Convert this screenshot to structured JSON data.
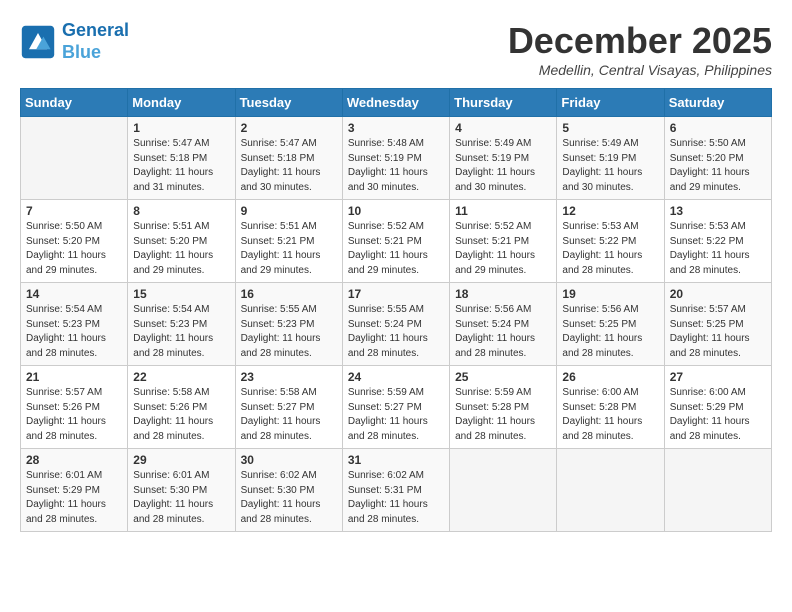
{
  "header": {
    "logo_line1": "General",
    "logo_line2": "Blue",
    "month": "December 2025",
    "location": "Medellin, Central Visayas, Philippines"
  },
  "weekdays": [
    "Sunday",
    "Monday",
    "Tuesday",
    "Wednesday",
    "Thursday",
    "Friday",
    "Saturday"
  ],
  "weeks": [
    [
      {
        "day": "",
        "info": ""
      },
      {
        "day": "1",
        "info": "Sunrise: 5:47 AM\nSunset: 5:18 PM\nDaylight: 11 hours\nand 31 minutes."
      },
      {
        "day": "2",
        "info": "Sunrise: 5:47 AM\nSunset: 5:18 PM\nDaylight: 11 hours\nand 30 minutes."
      },
      {
        "day": "3",
        "info": "Sunrise: 5:48 AM\nSunset: 5:19 PM\nDaylight: 11 hours\nand 30 minutes."
      },
      {
        "day": "4",
        "info": "Sunrise: 5:49 AM\nSunset: 5:19 PM\nDaylight: 11 hours\nand 30 minutes."
      },
      {
        "day": "5",
        "info": "Sunrise: 5:49 AM\nSunset: 5:19 PM\nDaylight: 11 hours\nand 30 minutes."
      },
      {
        "day": "6",
        "info": "Sunrise: 5:50 AM\nSunset: 5:20 PM\nDaylight: 11 hours\nand 29 minutes."
      }
    ],
    [
      {
        "day": "7",
        "info": "Sunrise: 5:50 AM\nSunset: 5:20 PM\nDaylight: 11 hours\nand 29 minutes."
      },
      {
        "day": "8",
        "info": "Sunrise: 5:51 AM\nSunset: 5:20 PM\nDaylight: 11 hours\nand 29 minutes."
      },
      {
        "day": "9",
        "info": "Sunrise: 5:51 AM\nSunset: 5:21 PM\nDaylight: 11 hours\nand 29 minutes."
      },
      {
        "day": "10",
        "info": "Sunrise: 5:52 AM\nSunset: 5:21 PM\nDaylight: 11 hours\nand 29 minutes."
      },
      {
        "day": "11",
        "info": "Sunrise: 5:52 AM\nSunset: 5:21 PM\nDaylight: 11 hours\nand 29 minutes."
      },
      {
        "day": "12",
        "info": "Sunrise: 5:53 AM\nSunset: 5:22 PM\nDaylight: 11 hours\nand 28 minutes."
      },
      {
        "day": "13",
        "info": "Sunrise: 5:53 AM\nSunset: 5:22 PM\nDaylight: 11 hours\nand 28 minutes."
      }
    ],
    [
      {
        "day": "14",
        "info": "Sunrise: 5:54 AM\nSunset: 5:23 PM\nDaylight: 11 hours\nand 28 minutes."
      },
      {
        "day": "15",
        "info": "Sunrise: 5:54 AM\nSunset: 5:23 PM\nDaylight: 11 hours\nand 28 minutes."
      },
      {
        "day": "16",
        "info": "Sunrise: 5:55 AM\nSunset: 5:23 PM\nDaylight: 11 hours\nand 28 minutes."
      },
      {
        "day": "17",
        "info": "Sunrise: 5:55 AM\nSunset: 5:24 PM\nDaylight: 11 hours\nand 28 minutes."
      },
      {
        "day": "18",
        "info": "Sunrise: 5:56 AM\nSunset: 5:24 PM\nDaylight: 11 hours\nand 28 minutes."
      },
      {
        "day": "19",
        "info": "Sunrise: 5:56 AM\nSunset: 5:25 PM\nDaylight: 11 hours\nand 28 minutes."
      },
      {
        "day": "20",
        "info": "Sunrise: 5:57 AM\nSunset: 5:25 PM\nDaylight: 11 hours\nand 28 minutes."
      }
    ],
    [
      {
        "day": "21",
        "info": "Sunrise: 5:57 AM\nSunset: 5:26 PM\nDaylight: 11 hours\nand 28 minutes."
      },
      {
        "day": "22",
        "info": "Sunrise: 5:58 AM\nSunset: 5:26 PM\nDaylight: 11 hours\nand 28 minutes."
      },
      {
        "day": "23",
        "info": "Sunrise: 5:58 AM\nSunset: 5:27 PM\nDaylight: 11 hours\nand 28 minutes."
      },
      {
        "day": "24",
        "info": "Sunrise: 5:59 AM\nSunset: 5:27 PM\nDaylight: 11 hours\nand 28 minutes."
      },
      {
        "day": "25",
        "info": "Sunrise: 5:59 AM\nSunset: 5:28 PM\nDaylight: 11 hours\nand 28 minutes."
      },
      {
        "day": "26",
        "info": "Sunrise: 6:00 AM\nSunset: 5:28 PM\nDaylight: 11 hours\nand 28 minutes."
      },
      {
        "day": "27",
        "info": "Sunrise: 6:00 AM\nSunset: 5:29 PM\nDaylight: 11 hours\nand 28 minutes."
      }
    ],
    [
      {
        "day": "28",
        "info": "Sunrise: 6:01 AM\nSunset: 5:29 PM\nDaylight: 11 hours\nand 28 minutes."
      },
      {
        "day": "29",
        "info": "Sunrise: 6:01 AM\nSunset: 5:30 PM\nDaylight: 11 hours\nand 28 minutes."
      },
      {
        "day": "30",
        "info": "Sunrise: 6:02 AM\nSunset: 5:30 PM\nDaylight: 11 hours\nand 28 minutes."
      },
      {
        "day": "31",
        "info": "Sunrise: 6:02 AM\nSunset: 5:31 PM\nDaylight: 11 hours\nand 28 minutes."
      },
      {
        "day": "",
        "info": ""
      },
      {
        "day": "",
        "info": ""
      },
      {
        "day": "",
        "info": ""
      }
    ]
  ]
}
